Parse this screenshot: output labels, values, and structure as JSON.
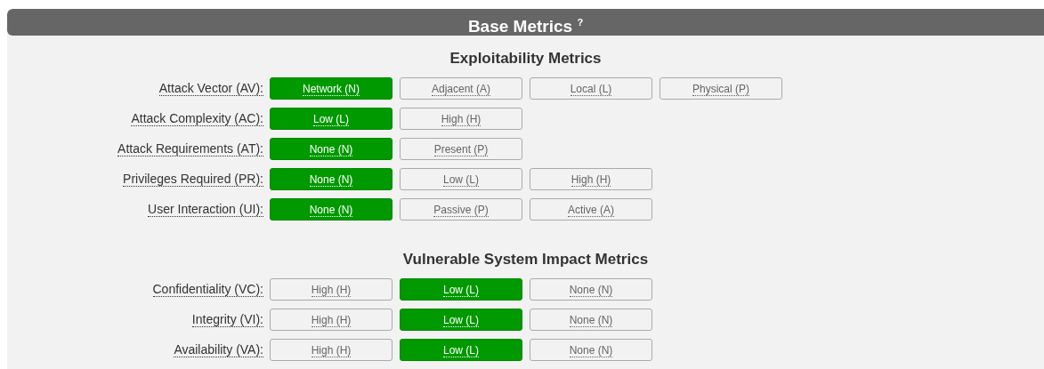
{
  "panel": {
    "title": "Base Metrics $^{?}$"
  },
  "sections": [
    {
      "title": "Exploitability Metrics",
      "metrics": [
        {
          "label": "Attack Vector (AV):",
          "options": [
            {
              "label": "Network (N)",
              "selected": true
            },
            {
              "label": "Adjacent (A)",
              "selected": false
            },
            {
              "label": "Local (L)",
              "selected": false
            },
            {
              "label": "Physical (P)",
              "selected": false
            }
          ]
        },
        {
          "label": "Attack Complexity (AC):",
          "options": [
            {
              "label": "Low (L)",
              "selected": true
            },
            {
              "label": "High (H)",
              "selected": false
            }
          ]
        },
        {
          "label": "Attack Requirements (AT):",
          "options": [
            {
              "label": "None (N)",
              "selected": true
            },
            {
              "label": "Present (P)",
              "selected": false
            }
          ]
        },
        {
          "label": "Privileges Required (PR):",
          "options": [
            {
              "label": "None (N)",
              "selected": true
            },
            {
              "label": "Low (L)",
              "selected": false
            },
            {
              "label": "High (H)",
              "selected": false
            }
          ]
        },
        {
          "label": "User Interaction (UI):",
          "options": [
            {
              "label": "None (N)",
              "selected": true
            },
            {
              "label": "Passive (P)",
              "selected": false
            },
            {
              "label": "Active (A)",
              "selected": false
            }
          ]
        }
      ]
    },
    {
      "title": "Vulnerable System Impact Metrics",
      "metrics": [
        {
          "label": "Confidentiality (VC):",
          "options": [
            {
              "label": "High (H)",
              "selected": false
            },
            {
              "label": "Low (L)",
              "selected": true
            },
            {
              "label": "None (N)",
              "selected": false
            }
          ]
        },
        {
          "label": "Integrity (VI):",
          "options": [
            {
              "label": "High (H)",
              "selected": false
            },
            {
              "label": "Low (L)",
              "selected": true
            },
            {
              "label": "None (N)",
              "selected": false
            }
          ]
        },
        {
          "label": "Availability (VA):",
          "options": [
            {
              "label": "High (H)",
              "selected": false
            },
            {
              "label": "Low (L)",
              "selected": true
            },
            {
              "label": "None (N)",
              "selected": false
            }
          ]
        }
      ]
    }
  ]
}
